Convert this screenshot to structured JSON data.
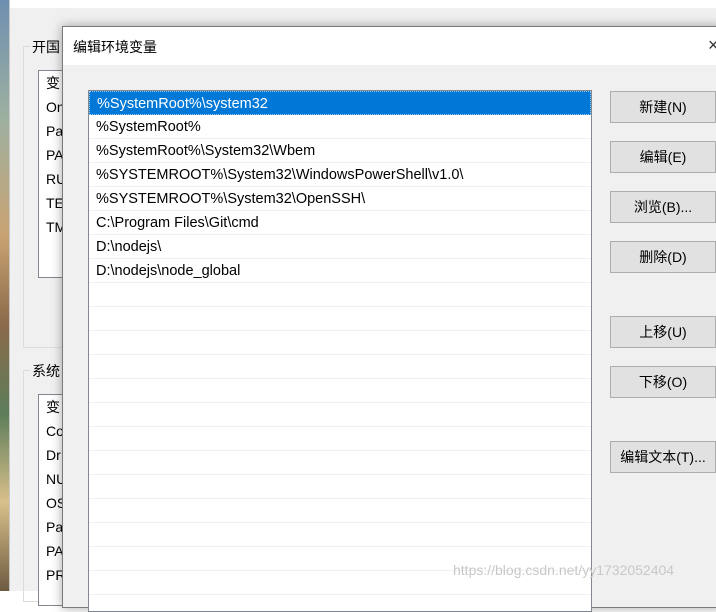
{
  "background_window": {
    "user_group_title": "开国",
    "user_list": [
      "变",
      "On",
      "Pa",
      "PA",
      "RU",
      "TE",
      "TM"
    ],
    "system_group_title": "系统",
    "system_list": [
      "变",
      "Co",
      "Dr",
      "NU",
      "OS",
      "Pa",
      "PA",
      "PR"
    ]
  },
  "dialog": {
    "title": "编辑环境变量",
    "close_glyph": "×",
    "entries": [
      "%SystemRoot%\\system32",
      "%SystemRoot%",
      "%SystemRoot%\\System32\\Wbem",
      "%SYSTEMROOT%\\System32\\WindowsPowerShell\\v1.0\\",
      "%SYSTEMROOT%\\System32\\OpenSSH\\",
      "C:\\Program Files\\Git\\cmd",
      "D:\\nodejs\\",
      "D:\\nodejs\\node_global"
    ],
    "selected_index": 0,
    "buttons": {
      "new": "新建(N)",
      "edit": "编辑(E)",
      "browse": "浏览(B)...",
      "delete": "删除(D)",
      "move_up": "上移(U)",
      "move_down": "下移(O)",
      "edit_text": "编辑文本(T)..."
    }
  },
  "watermark": "https://blog.csdn.net/yy1732052404",
  "colors": {
    "selection": "#0078d7",
    "dialog_bg": "#f0f0f0",
    "button_bg": "#e1e1e1"
  }
}
